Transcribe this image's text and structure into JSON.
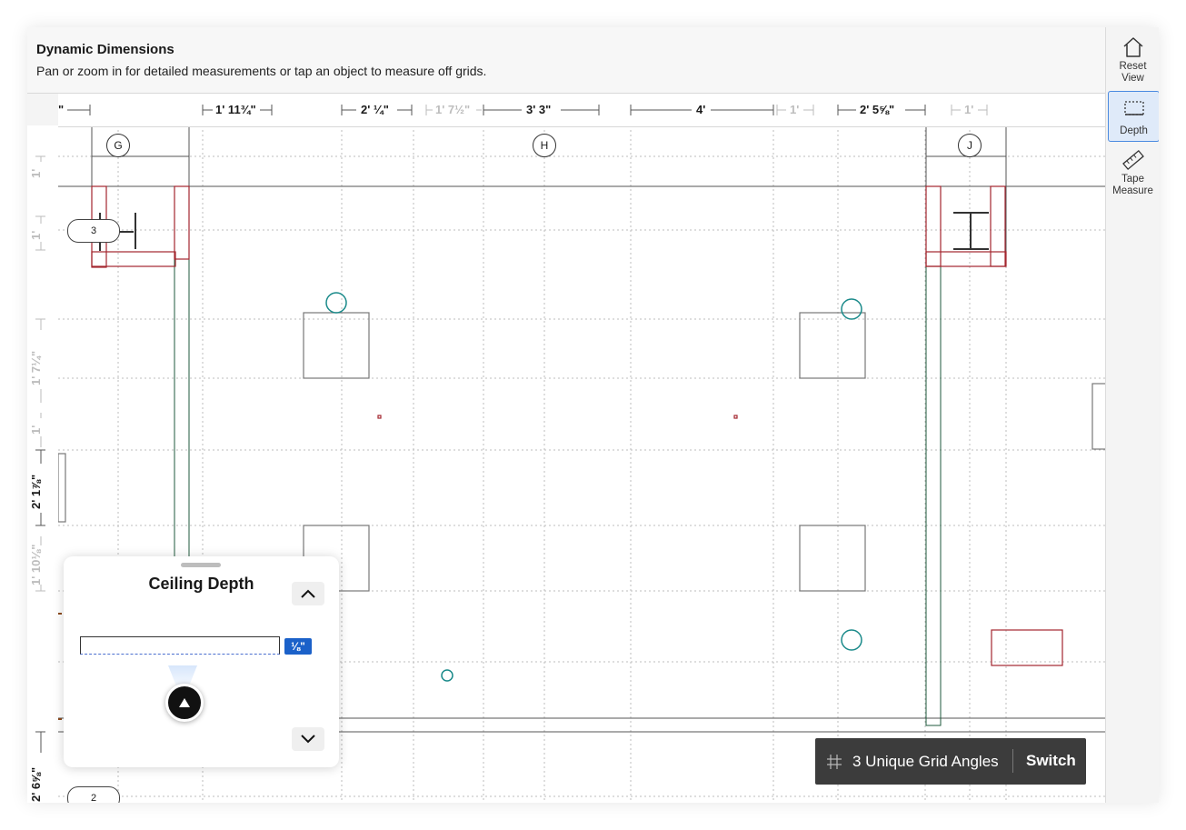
{
  "header": {
    "title": "Dynamic Dimensions",
    "subtitle": "Pan or zoom in for detailed measurements or tap an object to measure off grids."
  },
  "ruler_top": [
    {
      "text": "\"",
      "dim": false
    },
    {
      "text": "1' 11¾\"",
      "dim": false
    },
    {
      "text": "2' ¼\"",
      "dim": false
    },
    {
      "text": "1' 7½\"",
      "dim": true
    },
    {
      "text": "3' 3\"",
      "dim": false
    },
    {
      "text": "4'",
      "dim": false
    },
    {
      "text": "1'",
      "dim": true
    },
    {
      "text": "2' 5⅝\"",
      "dim": false
    },
    {
      "text": "1'",
      "dim": true
    }
  ],
  "ruler_left": [
    {
      "text": "1'",
      "dim": true
    },
    {
      "text": "1'",
      "dim": true
    },
    {
      "text": "1' 7¼\"",
      "dim": true
    },
    {
      "text": "1'",
      "dim": true
    },
    {
      "text": "2' 1⅞\"",
      "dim": false
    },
    {
      "text": "1' 10⅛\"",
      "dim": true
    },
    {
      "text": "2' 6⅝\"",
      "dim": false
    }
  ],
  "grid_labels": [
    "G",
    "H",
    "J"
  ],
  "level_labels": [
    "3",
    "2"
  ],
  "toolbar": {
    "reset_label": "Reset View",
    "depth_label": "Depth",
    "tape_label": "Tape Measure",
    "active": "Depth"
  },
  "depth_panel": {
    "title": "Ceiling Depth",
    "input_value": "",
    "unit": "⅛\""
  },
  "toast": {
    "text": "3 Unique Grid Angles",
    "action": "Switch"
  },
  "colors": {
    "accent": "#1b61c9",
    "beam": "#a3262e",
    "column": "#1f5a3c",
    "circle": "#1a8a8a"
  }
}
